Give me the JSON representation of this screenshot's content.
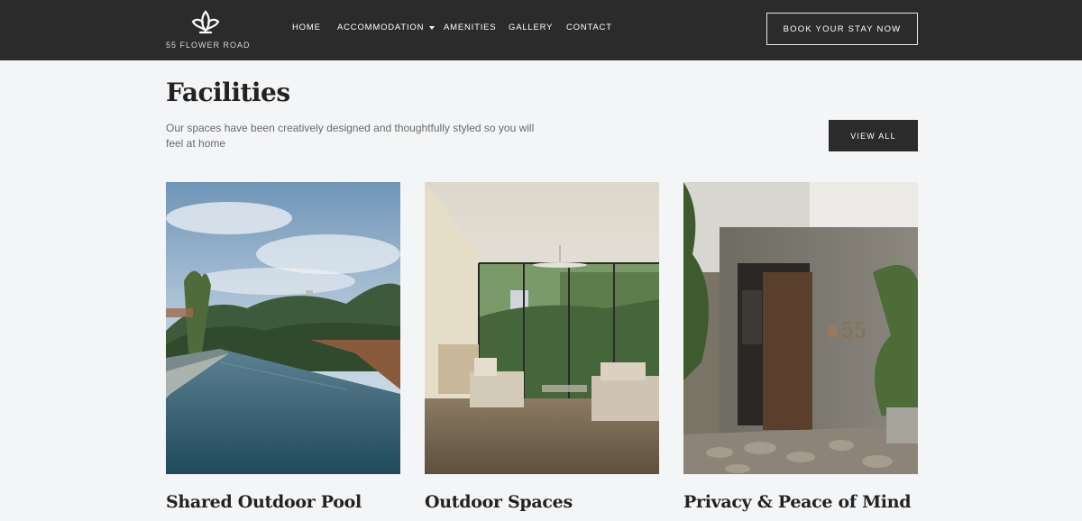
{
  "brand": {
    "name": "55 FLOWER ROAD",
    "logo_icon": "flower-logo-icon"
  },
  "nav": {
    "items": [
      {
        "label": "HOME"
      },
      {
        "label": "ACCOMMODATION",
        "has_dropdown": true
      },
      {
        "label": "AMENITIES"
      },
      {
        "label": "GALLERY"
      },
      {
        "label": "CONTACT"
      }
    ],
    "cta": "BOOK YOUR STAY NOW"
  },
  "section": {
    "title": "Facilities",
    "description": "Our spaces have been creatively designed and thoughtfully styled so you will feel at home",
    "view_all": "VIEW ALL"
  },
  "cards": [
    {
      "title": "Shared Outdoor Pool",
      "image": "infinity-pool-photo"
    },
    {
      "title": "Outdoor Spaces",
      "image": "living-room-photo"
    },
    {
      "title": "Privacy & Peace of Mind",
      "image": "entrance-door-photo"
    }
  ],
  "colors": {
    "header_bg": "#2b2b2b",
    "page_bg": "#f4f5f7",
    "button_bg": "#2b2b2b"
  }
}
